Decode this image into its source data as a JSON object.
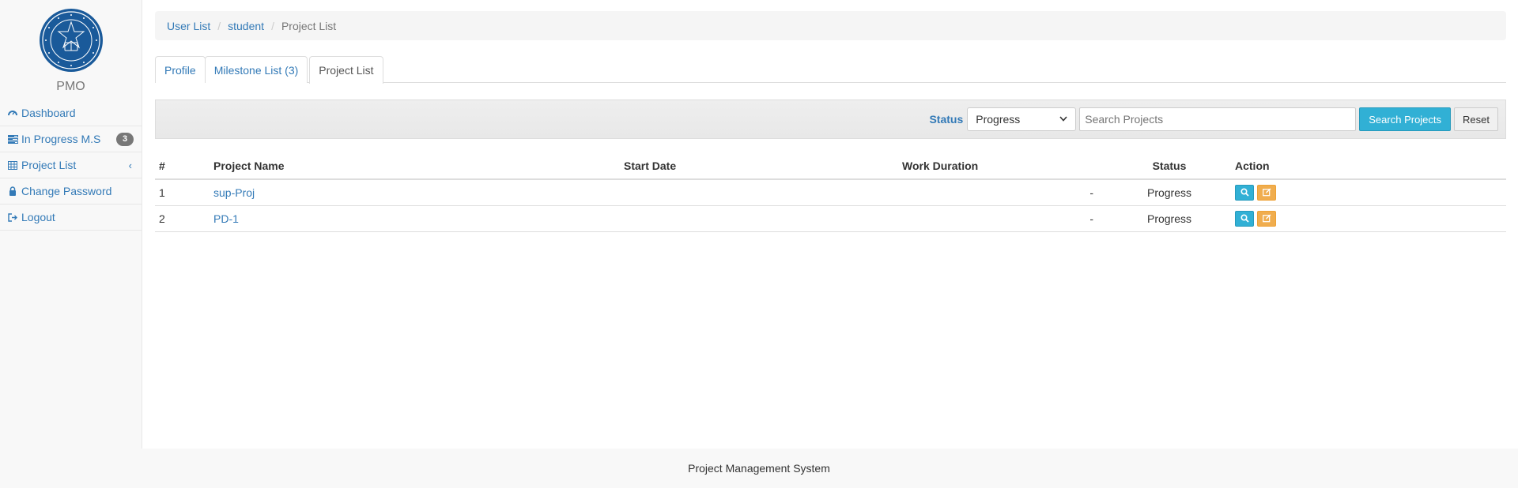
{
  "sidebar": {
    "brand": "PMO",
    "items": [
      {
        "label": "Dashboard",
        "icon": "dashboard-icon"
      },
      {
        "label": "In Progress M.S",
        "icon": "tasks-icon",
        "badge": "3"
      },
      {
        "label": "Project List",
        "icon": "table-icon",
        "caret": "chevron-left-icon"
      },
      {
        "label": "Change Password",
        "icon": "lock-icon"
      },
      {
        "label": "Logout",
        "icon": "sign-out-icon"
      }
    ]
  },
  "breadcrumb": [
    "User List",
    "student",
    "Project List"
  ],
  "tabs": [
    {
      "label": "Profile"
    },
    {
      "label": "Milestone List (3)"
    },
    {
      "label": "Project List",
      "active": true
    }
  ],
  "filter": {
    "status_label": "Status",
    "status_value": "Progress",
    "search_placeholder": "Search Projects",
    "search_button": "Search Projects",
    "reset_button": "Reset"
  },
  "table": {
    "headers": [
      "#",
      "Project Name",
      "Start Date",
      "Work Duration",
      "Status",
      "Action"
    ],
    "rows": [
      {
        "num": "1",
        "name": "sup-Proj",
        "start": "",
        "duration": "-",
        "status": "Progress"
      },
      {
        "num": "2",
        "name": "PD-1",
        "start": "",
        "duration": "-",
        "status": "Progress"
      }
    ]
  },
  "footer": "Project Management System",
  "colors": {
    "link": "#337ab7",
    "info": "#31b0d5",
    "warning": "#f0ad4e",
    "logo": "#1a5a9a"
  }
}
